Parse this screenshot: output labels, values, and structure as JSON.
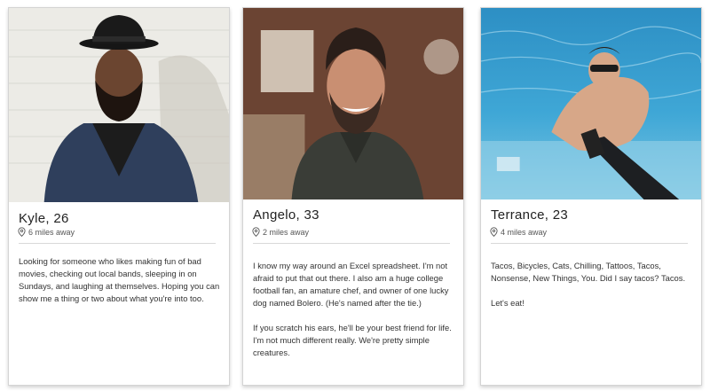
{
  "profiles": [
    {
      "name_age": "Kyle, 26",
      "distance": "6 miles away",
      "bio": [
        "Looking for someone who likes making fun of bad movies, checking out local bands, sleeping in on Sundays, and laughing at themselves. Hoping you can show me a thing or two about what you're into too."
      ]
    },
    {
      "name_age": "Angelo, 33",
      "distance": "2 miles away",
      "bio": [
        "I know my way around an Excel spreadsheet. I'm not afraid to put that out there. I also am a huge college football fan, an amature chef, and owner of one lucky dog named Bolero. (He's named after the tie.)",
        "If you scratch his ears, he'll be your best friend for life. I'm not much different really. We're pretty simple creatures."
      ]
    },
    {
      "name_age": "Terrance, 23",
      "distance": "4 miles away",
      "bio": [
        "Tacos, Bicycles, Cats, Chilling, Tattoos, Tacos, Nonsense, New Things, You. Did I say tacos? Tacos.",
        "Let's eat!"
      ]
    }
  ]
}
